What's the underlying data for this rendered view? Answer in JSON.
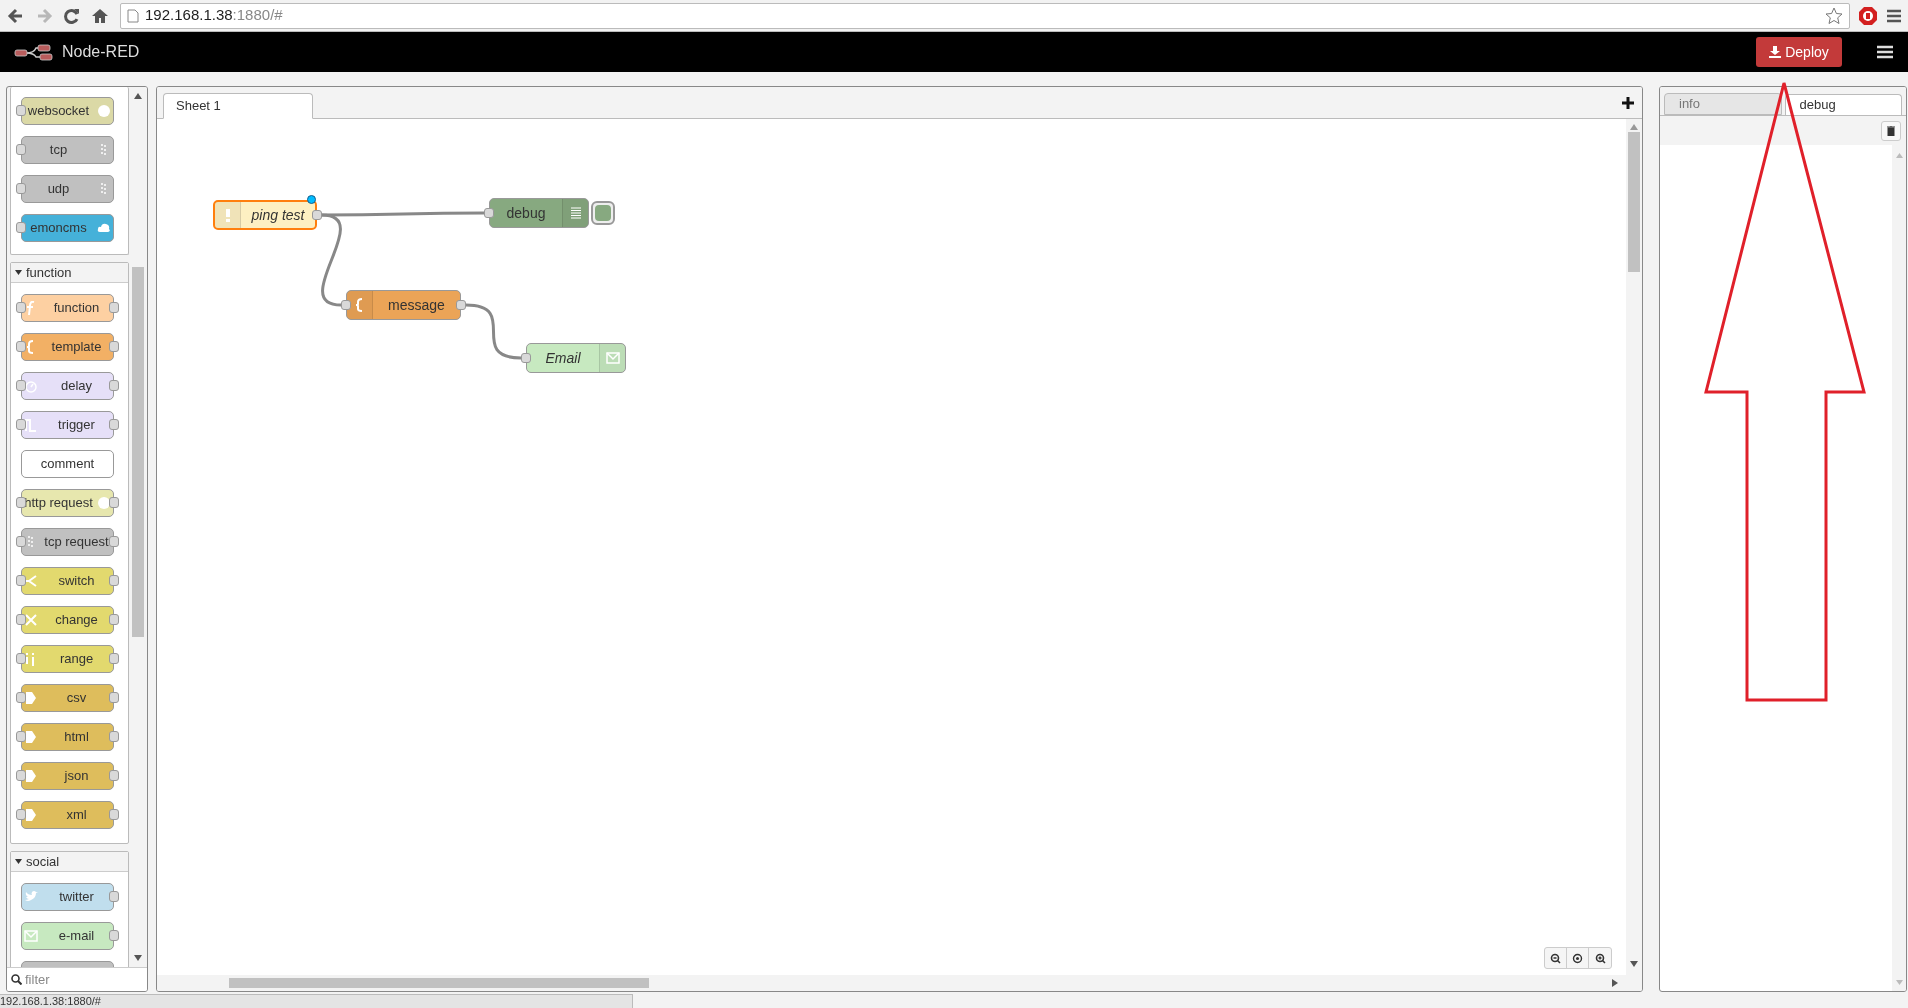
{
  "browser": {
    "nav": [
      {
        "kind": "back",
        "disabled": false
      },
      {
        "kind": "forward",
        "disabled": true
      },
      {
        "kind": "reload",
        "disabled": false
      },
      {
        "kind": "home",
        "disabled": false
      }
    ],
    "url_host": "192.168.1.38",
    "url_path": ":1880/#"
  },
  "header": {
    "title": "Node-RED",
    "deploy": "Deploy"
  },
  "palette": {
    "sections": [
      {
        "items": [
          {
            "label": "websocket",
            "color": "#dbd9a6",
            "kind": "websocket",
            "inputs": true,
            "outputs": false
          },
          {
            "label": "tcp",
            "color": "#c0c0c0",
            "kind": "socket",
            "inputs": true,
            "outputs": false
          },
          {
            "label": "udp",
            "color": "#c0c0c0",
            "kind": "socket",
            "inputs": true,
            "outputs": false
          },
          {
            "label": "emoncms",
            "color": "#45b1d9",
            "kind": "cloud",
            "inputs": true,
            "outputs": false
          }
        ]
      },
      {
        "title": "function",
        "expanded": true,
        "items": [
          {
            "label": "function",
            "color": "#fdd0a2",
            "kind": "function",
            "inputs": true,
            "outputs": true
          },
          {
            "label": "template",
            "color": "#f2b065",
            "kind": "template",
            "inputs": true,
            "outputs": true
          },
          {
            "label": "delay",
            "color": "#e6e0f8",
            "kind": "delay",
            "inputs": true,
            "outputs": true
          },
          {
            "label": "trigger",
            "color": "#e6e0f8",
            "kind": "trigger",
            "inputs": true,
            "outputs": true
          },
          {
            "label": "comment",
            "color": "#ffffff",
            "kind": "comment",
            "inputs": false,
            "outputs": false
          },
          {
            "label": "http request",
            "color": "#e7e7ae",
            "kind": "websocket",
            "inputs": true,
            "outputs": true
          },
          {
            "label": "tcp request",
            "color": "#c0c0c0",
            "kind": "request",
            "inputs": true,
            "outputs": true
          },
          {
            "label": "switch",
            "color": "#e2d96e",
            "kind": "switch",
            "inputs": true,
            "outputs": true
          },
          {
            "label": "change",
            "color": "#e2d96e",
            "kind": "change",
            "inputs": true,
            "outputs": true
          },
          {
            "label": "range",
            "color": "#e2d96e",
            "kind": "range",
            "inputs": true,
            "outputs": true
          },
          {
            "label": "csv",
            "color": "#debd5c",
            "kind": "parser",
            "inputs": true,
            "outputs": true
          },
          {
            "label": "html",
            "color": "#debd5c",
            "kind": "parser",
            "inputs": true,
            "outputs": true
          },
          {
            "label": "json",
            "color": "#debd5c",
            "kind": "parser",
            "inputs": true,
            "outputs": true
          },
          {
            "label": "xml",
            "color": "#debd5c",
            "kind": "parser",
            "inputs": true,
            "outputs": true
          }
        ]
      },
      {
        "title": "social",
        "expanded": true,
        "items": [
          {
            "label": "twitter",
            "color": "#c0deed",
            "kind": "twitter",
            "inputs": false,
            "outputs": true
          },
          {
            "label": "e-mail",
            "color": "#c7e9c0",
            "kind": "email",
            "inputs": false,
            "outputs": true
          },
          {
            "color": "#c0c0c0",
            "kind": "comment",
            "inputs": false,
            "outputs": false
          }
        ]
      }
    ],
    "filter_placeholder": "filter"
  },
  "workspace": {
    "tabs": [
      {
        "label": "Sheet 1",
        "selected": true
      }
    ],
    "nodes": [
      {
        "label": "ping test",
        "color": "#fdf0c2",
        "kind": "inject",
        "italic": true,
        "inputs": false,
        "outputs": true,
        "selected": true,
        "changed": true
      },
      {
        "label": "debug",
        "color": "#87a980",
        "kind": "debug",
        "italic": false,
        "inputs": true,
        "outputs": false,
        "selected": false,
        "changed": false,
        "toggle": true
      },
      {
        "label": "message",
        "color": "#eba457",
        "kind": "template",
        "italic": false,
        "inputs": true,
        "outputs": true,
        "selected": false,
        "changed": false
      },
      {
        "label": "Email",
        "color": "#c7e9c0",
        "kind": "email-out",
        "italic": true,
        "inputs": true,
        "outputs": false,
        "selected": false,
        "changed": false
      }
    ]
  },
  "sidebar": {
    "tabs": [
      {
        "label": "info",
        "selected": false
      },
      {
        "label": "debug",
        "selected": true
      }
    ]
  },
  "status_bar": "192.168.1.38:1880/#"
}
